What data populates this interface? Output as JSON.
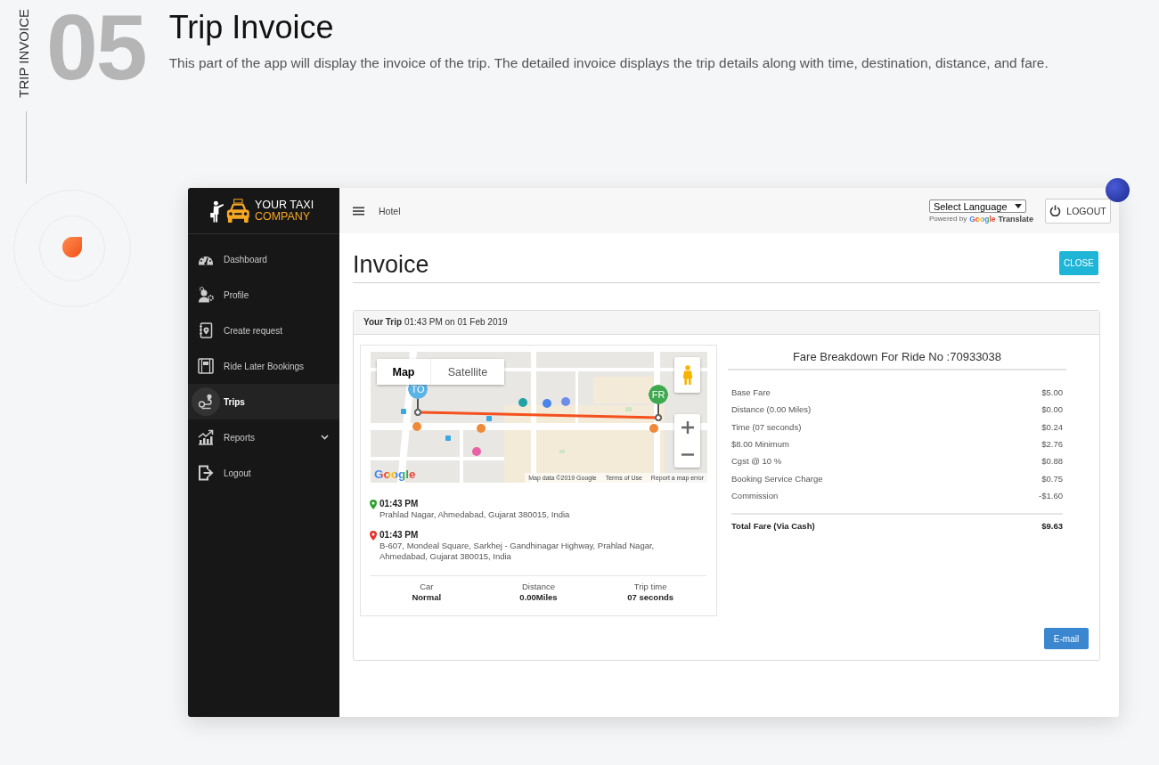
{
  "section": {
    "side_label": "TRIP INVOICE",
    "number": "05",
    "title": "Trip Invoice",
    "description": "This part of the app will display the invoice of the trip. The detailed invoice displays the trip details along with time, destination, distance, and fare."
  },
  "app": {
    "logo": {
      "line_1": "YOUR TAXI",
      "line_2": "COMPANY"
    },
    "sidebar": {
      "items": [
        {
          "label": "Dashboard",
          "selected": false,
          "has_submenu": false
        },
        {
          "label": "Profile",
          "selected": false,
          "has_submenu": false
        },
        {
          "label": "Create request",
          "selected": false,
          "has_submenu": false
        },
        {
          "label": "Ride Later Bookings",
          "selected": false,
          "has_submenu": false
        },
        {
          "label": "Trips",
          "selected": true,
          "has_submenu": false
        },
        {
          "label": "Reports",
          "selected": false,
          "has_submenu": true
        },
        {
          "label": "Logout",
          "selected": false,
          "has_submenu": false
        }
      ]
    },
    "topbar": {
      "page_label": "Hotel",
      "language_select": {
        "value": "Select Language"
      },
      "translate_credit": {
        "prefix": "Powered by",
        "brand": "Google",
        "product": "Translate"
      },
      "logout_button": "LOGOUT"
    },
    "invoice": {
      "title": "Invoice",
      "close_button": "CLOSE",
      "trip_header": "**Your Trip** 01:43 PM on 01 Feb 2019",
      "map": {
        "type_tabs": [
          {
            "label": "Map",
            "selected": true
          },
          {
            "label": "Satellite",
            "selected": false
          }
        ],
        "markers": [
          {
            "label": "TO",
            "color": "#5ab4e5"
          },
          {
            "label": "FR",
            "color": "#3fa950"
          }
        ],
        "logo": "Google",
        "attribution": {
          "data_credit": "Map data ©2019 Google",
          "links": [
            "Terms of Use",
            "Report a map error"
          ]
        }
      },
      "stops": [
        {
          "time": "01:43 PM",
          "address": "Prahlad Nagar, Ahmedabad, Gujarat 380015, India",
          "color": "#2ea12e"
        },
        {
          "time": "01:43 PM",
          "address": "B-607, Mondeal Square, Sarkhej - Gandhinagar Highway, Prahlad Nagar, Ahmedabad, Gujarat 380015, India",
          "color": "#e8312a"
        }
      ],
      "summary": [
        {
          "label": "Car",
          "value": "Normal"
        },
        {
          "label": "Distance",
          "value": "0.00Miles"
        },
        {
          "label": "Trip time",
          "value": "07 seconds"
        }
      ],
      "fare": {
        "title": "Fare Breakdown For Ride No :70933038",
        "items": [
          {
            "label": "Base Fare",
            "amount": "$5.00"
          },
          {
            "label": "Distance (0.00 Miles)",
            "amount": "$0.00"
          },
          {
            "label": "Time (07 seconds)",
            "amount": "$0.24"
          },
          {
            "label": "$8.00 Minimum",
            "amount": "$2.76"
          },
          {
            "label": "Cgst @ 10 %",
            "amount": "$0.88"
          },
          {
            "label": "Booking Service Charge",
            "amount": "$0.75"
          },
          {
            "label": "Commission",
            "amount": "-$1.60"
          }
        ],
        "total": {
          "label": "Total Fare (Via Cash)",
          "amount": "$9.63"
        }
      },
      "email_button": "E-mail"
    }
  }
}
